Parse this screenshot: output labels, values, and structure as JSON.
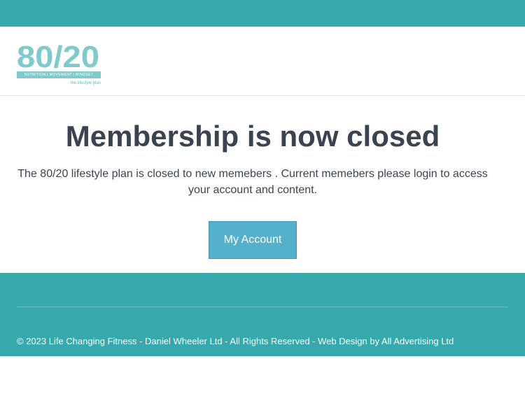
{
  "header": {
    "logo": {
      "number": "80/20",
      "strip": "NUTRITION | MOVEMENT | MINDSET",
      "tagline": "the lifestyle plan"
    }
  },
  "main": {
    "title": "Membership is now closed",
    "intro": "The 80/20 lifestyle plan is closed to new memebers . Current memebers please login to access your account and content.",
    "button_label": "My Account"
  },
  "footer": {
    "copyright": "© 2023 Life Changing Fitness - Daniel Wheeler Ltd - All Rights Reserved - Web Design by All Advertising Ltd"
  },
  "colors": {
    "brand_teal": "#35a9ab",
    "logo_teal": "#7fcacb",
    "button_blue": "#55b0cc",
    "title_text": "#3a4350"
  }
}
